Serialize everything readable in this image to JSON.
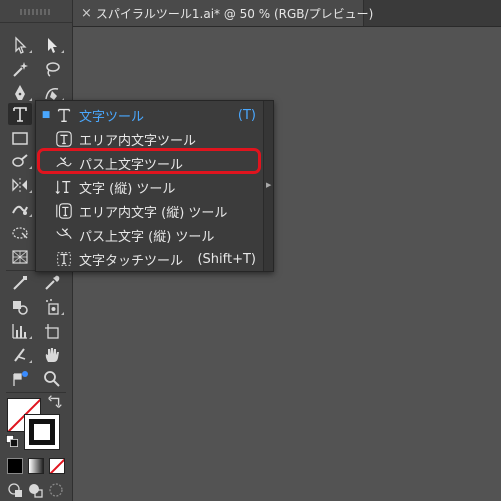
{
  "document_tab": {
    "close_glyph": "×",
    "title": "スパイラルツール1.ai* @ 50 % (RGB/プレビュー)"
  },
  "toolbar": {
    "tools": [
      {
        "name": "selection-tool"
      },
      {
        "name": "direct-selection-tool"
      },
      {
        "name": "magic-wand-tool"
      },
      {
        "name": "lasso-tool"
      },
      {
        "name": "pen-tool"
      },
      {
        "name": "curvature-tool"
      },
      {
        "name": "type-tool",
        "active": true
      },
      {
        "name": "rectangle-tool"
      },
      {
        "name": "paintbrush-tool"
      },
      {
        "name": "reflect-tool"
      },
      {
        "name": "warp-tool"
      },
      {
        "name": "free-transform-tool"
      },
      {
        "name": "perspective-grid-tool"
      },
      {
        "name": "eyedropper-tool"
      },
      {
        "name": "blend-tool"
      },
      {
        "name": "symbol-sprayer-tool"
      },
      {
        "name": "column-graph-tool"
      },
      {
        "name": "artboard-tool"
      },
      {
        "name": "slice-tool"
      },
      {
        "name": "hand-tool"
      },
      {
        "name": "zoom-tool"
      }
    ],
    "colors": {
      "fill": "#ffffff",
      "stroke": "#000000",
      "none_slash": "#e0141e"
    }
  },
  "flyout": {
    "items": [
      {
        "label": "文字ツール",
        "shortcut": "(T)",
        "selected": true,
        "icon": "type-icon"
      },
      {
        "label": "エリア内文字ツール",
        "shortcut": "",
        "selected": false,
        "icon": "area-type-icon"
      },
      {
        "label": "パス上文字ツール",
        "shortcut": "",
        "selected": false,
        "icon": "type-on-path-icon",
        "highlighted": true
      },
      {
        "label": "文字 (縦) ツール",
        "shortcut": "",
        "selected": false,
        "icon": "vertical-type-icon"
      },
      {
        "label": "エリア内文字 (縦) ツール",
        "shortcut": "",
        "selected": false,
        "icon": "vertical-area-type-icon"
      },
      {
        "label": "パス上文字 (縦) ツール",
        "shortcut": "",
        "selected": false,
        "icon": "vertical-type-on-path-icon"
      },
      {
        "label": "文字タッチツール",
        "shortcut": "(Shift+T)",
        "selected": false,
        "icon": "touch-type-icon"
      }
    ],
    "highlight_color": "#e0141e",
    "accent_color": "#4aa8ff"
  }
}
